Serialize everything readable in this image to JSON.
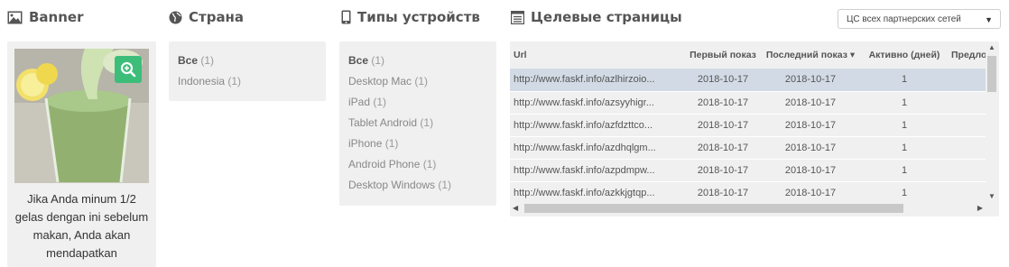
{
  "banner": {
    "title": "Banner",
    "caption": "Jika Anda minum 1/2 gelas dengan ini sebelum makan, Anda akan mendapatkan"
  },
  "country": {
    "title": "Страна",
    "items": [
      {
        "label": "Все",
        "count": "(1)"
      },
      {
        "label": "Indonesia",
        "count": "(1)"
      }
    ]
  },
  "devices": {
    "title": "Типы устройств",
    "items": [
      {
        "label": "Все",
        "count": "(1)"
      },
      {
        "label": "Desktop Mac",
        "count": "(1)"
      },
      {
        "label": "iPad",
        "count": "(1)"
      },
      {
        "label": "Tablet Android",
        "count": "(1)"
      },
      {
        "label": "iPhone",
        "count": "(1)"
      },
      {
        "label": "Android Phone",
        "count": "(1)"
      },
      {
        "label": "Desktop Windows",
        "count": "(1)"
      }
    ]
  },
  "pages": {
    "title": "Целевые страницы",
    "dropdown_value": "ЦС всех партнерских сетей",
    "columns": [
      "Url",
      "Первый показ",
      "Последний показ ▾",
      "Активно (дней)",
      "Предложение"
    ],
    "rows": [
      [
        "http://www.faskf.info/azlhirzoio...",
        "2018-10-17",
        "2018-10-17",
        "1",
        ""
      ],
      [
        "http://www.faskf.info/azsyyhigr...",
        "2018-10-17",
        "2018-10-17",
        "1",
        ""
      ],
      [
        "http://www.faskf.info/azfdzttco...",
        "2018-10-17",
        "2018-10-17",
        "1",
        ""
      ],
      [
        "http://www.faskf.info/azdhqlgm...",
        "2018-10-17",
        "2018-10-17",
        "1",
        ""
      ],
      [
        "http://www.faskf.info/azpdmpw...",
        "2018-10-17",
        "2018-10-17",
        "1",
        ""
      ],
      [
        "http://www.faskf.info/azkkjgtqp...",
        "2018-10-17",
        "2018-10-17",
        "1",
        ""
      ]
    ]
  }
}
